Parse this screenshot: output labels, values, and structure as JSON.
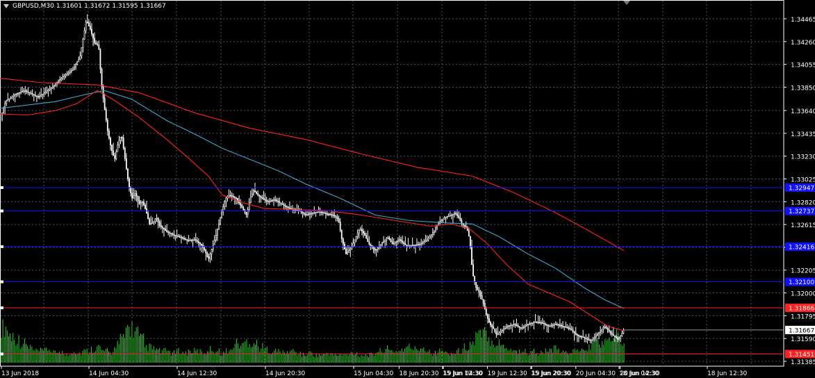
{
  "header": {
    "symbol": "GBPUSD,M30",
    "open": "1.31601",
    "high": "1.31672",
    "low": "1.31595",
    "close": "1.31667"
  },
  "colors": {
    "background": "#000000",
    "grid": "#4a5260",
    "axis": "#ffffff",
    "bull_candle": "#ffffff",
    "bear_candle": "#ffffff",
    "volume": "#2bcf2b",
    "ma_fast": "#ff2020",
    "ma_slow": "#ff2020",
    "ma_mid": "#3aa7c8",
    "blue_level": "#1010ff",
    "red_level": "#ff2020",
    "price_tag_bg": "#ffffff"
  },
  "price_axis": {
    "labels": [
      "1.34465",
      "1.34260",
      "1.34055",
      "1.33850",
      "1.33640",
      "1.33435",
      "1.33230",
      "1.33025",
      "1.32820",
      "1.32615",
      "1.32410",
      "1.32205",
      "1.32000",
      "1.31795",
      "1.31590",
      "1.31385"
    ],
    "current_price": "1.31667",
    "level_tags": [
      {
        "label": "1.32947",
        "kind": "blue"
      },
      {
        "label": "1.32737",
        "kind": "blue"
      },
      {
        "label": "1.32416",
        "kind": "blue"
      },
      {
        "label": "1.32100",
        "kind": "blue"
      },
      {
        "label": "1.31866",
        "kind": "red"
      },
      {
        "label": "1.31451",
        "kind": "red"
      }
    ]
  },
  "time_axis": {
    "labels": [
      "13 Jun 2018",
      "14 Jun 04:30",
      "14 Jun 12:30",
      "14 Jun 20:30",
      "15 Jun 04:30",
      "15 Jun 12:30",
      "15 Jun 20:30",
      "18 Jun 04:30",
      "18 Jun 12:30",
      "18 Jun 20:30",
      "19 Jun 04:30",
      "19 Jun 12:30",
      "19 Jun 20:30",
      "20 Jun 04:30",
      "20 Jun 12:30"
    ]
  },
  "chart_data": {
    "type": "candlestick",
    "symbol": "GBPUSD",
    "timeframe": "M30",
    "ylim": [
      1.31385,
      1.34465
    ],
    "y_ticks": [
      1.34465,
      1.3426,
      1.34055,
      1.3385,
      1.3364,
      1.33435,
      1.3323,
      1.33025,
      1.3282,
      1.32615,
      1.3241,
      1.32205,
      1.32,
      1.31795,
      1.3159,
      1.31385
    ],
    "x_tick_labels": [
      "13 Jun 2018",
      "14 Jun 04:30",
      "14 Jun 12:30",
      "14 Jun 20:30",
      "15 Jun 04:30",
      "15 Jun 12:30",
      "15 Jun 20:30",
      "18 Jun 04:30",
      "18 Jun 12:30",
      "18 Jun 20:30",
      "19 Jun 04:30",
      "19 Jun 12:30",
      "19 Jun 20:30",
      "20 Jun 04:30",
      "20 Jun 12:30"
    ],
    "close_path": [
      [
        0,
        1.3356
      ],
      [
        8,
        1.3372
      ],
      [
        20,
        1.3378
      ],
      [
        35,
        1.3382
      ],
      [
        55,
        1.3376
      ],
      [
        75,
        1.3385
      ],
      [
        90,
        1.3394
      ],
      [
        105,
        1.3401
      ],
      [
        115,
        1.3412
      ],
      [
        120,
        1.343
      ],
      [
        124,
        1.3445
      ],
      [
        130,
        1.3437
      ],
      [
        136,
        1.3425
      ],
      [
        142,
        1.3422
      ],
      [
        146,
        1.3388
      ],
      [
        150,
        1.3368
      ],
      [
        155,
        1.3345
      ],
      [
        160,
        1.333
      ],
      [
        165,
        1.332
      ],
      [
        170,
        1.3335
      ],
      [
        175,
        1.3342
      ],
      [
        180,
        1.332
      ],
      [
        185,
        1.3298
      ],
      [
        190,
        1.3285
      ],
      [
        195,
        1.329
      ],
      [
        200,
        1.328
      ],
      [
        205,
        1.3282
      ],
      [
        210,
        1.3274
      ],
      [
        215,
        1.3262
      ],
      [
        220,
        1.3263
      ],
      [
        225,
        1.3268
      ],
      [
        230,
        1.326
      ],
      [
        235,
        1.3258
      ],
      [
        240,
        1.3255
      ],
      [
        250,
        1.3252
      ],
      [
        260,
        1.325
      ],
      [
        270,
        1.3247
      ],
      [
        280,
        1.3248
      ],
      [
        290,
        1.3243
      ],
      [
        295,
        1.3238
      ],
      [
        300,
        1.323
      ],
      [
        305,
        1.324
      ],
      [
        310,
        1.325
      ],
      [
        315,
        1.3262
      ],
      [
        320,
        1.3275
      ],
      [
        325,
        1.3285
      ],
      [
        330,
        1.3288
      ],
      [
        340,
        1.3285
      ],
      [
        350,
        1.3275
      ],
      [
        355,
        1.327
      ],
      [
        360,
        1.3285
      ],
      [
        365,
        1.3292
      ],
      [
        375,
        1.3286
      ],
      [
        385,
        1.3282
      ],
      [
        395,
        1.3284
      ],
      [
        405,
        1.328
      ],
      [
        410,
        1.3278
      ],
      [
        420,
        1.3275
      ],
      [
        430,
        1.3274
      ],
      [
        440,
        1.327
      ],
      [
        450,
        1.3272
      ],
      [
        460,
        1.3273
      ],
      [
        470,
        1.3271
      ],
      [
        480,
        1.327
      ],
      [
        487,
        1.3266
      ],
      [
        492,
        1.3248
      ],
      [
        498,
        1.3235
      ],
      [
        505,
        1.324
      ],
      [
        512,
        1.325
      ],
      [
        518,
        1.3258
      ],
      [
        525,
        1.3252
      ],
      [
        530,
        1.3245
      ],
      [
        540,
        1.3238
      ],
      [
        550,
        1.3245
      ],
      [
        558,
        1.325
      ],
      [
        565,
        1.3244
      ],
      [
        575,
        1.3248
      ],
      [
        585,
        1.3242
      ],
      [
        595,
        1.3243
      ],
      [
        605,
        1.3244
      ],
      [
        615,
        1.3248
      ],
      [
        625,
        1.3256
      ],
      [
        630,
        1.3262
      ],
      [
        640,
        1.3268
      ],
      [
        650,
        1.327
      ],
      [
        655,
        1.3272
      ],
      [
        660,
        1.3268
      ],
      [
        665,
        1.3262
      ],
      [
        672,
        1.3258
      ],
      [
        676,
        1.3248
      ],
      [
        680,
        1.3218
      ],
      [
        685,
        1.3205
      ],
      [
        690,
        1.32
      ],
      [
        695,
        1.3192
      ],
      [
        700,
        1.318
      ],
      [
        705,
        1.3172
      ],
      [
        710,
        1.3168
      ],
      [
        715,
        1.3162
      ],
      [
        720,
        1.3165
      ],
      [
        730,
        1.317
      ],
      [
        740,
        1.3172
      ],
      [
        750,
        1.3168
      ],
      [
        760,
        1.3172
      ],
      [
        770,
        1.3174
      ],
      [
        780,
        1.3173
      ],
      [
        790,
        1.317
      ],
      [
        800,
        1.3172
      ],
      [
        810,
        1.317
      ],
      [
        820,
        1.3168
      ],
      [
        830,
        1.3162
      ],
      [
        840,
        1.316
      ],
      [
        850,
        1.3157
      ],
      [
        860,
        1.3163
      ],
      [
        870,
        1.317
      ],
      [
        880,
        1.3163
      ],
      [
        890,
        1.3158
      ],
      [
        898,
        1.31667
      ]
    ],
    "ma_fast_path": [
      [
        0,
        1.3361
      ],
      [
        40,
        1.336
      ],
      [
        80,
        1.3364
      ],
      [
        110,
        1.337
      ],
      [
        140,
        1.3382
      ],
      [
        160,
        1.3375
      ],
      [
        200,
        1.3358
      ],
      [
        240,
        1.3338
      ],
      [
        270,
        1.3322
      ],
      [
        300,
        1.3305
      ],
      [
        320,
        1.3288
      ],
      [
        350,
        1.3281
      ],
      [
        380,
        1.3276
      ],
      [
        420,
        1.3275
      ],
      [
        470,
        1.3274
      ],
      [
        520,
        1.327
      ],
      [
        570,
        1.3265
      ],
      [
        620,
        1.326
      ],
      [
        650,
        1.3262
      ],
      [
        675,
        1.3258
      ],
      [
        700,
        1.3245
      ],
      [
        730,
        1.3225
      ],
      [
        760,
        1.3208
      ],
      [
        790,
        1.32
      ],
      [
        820,
        1.3192
      ],
      [
        850,
        1.318
      ],
      [
        875,
        1.317
      ],
      [
        898,
        1.3166
      ]
    ],
    "ma_mid_path": [
      [
        0,
        1.3366
      ],
      [
        40,
        1.3369
      ],
      [
        80,
        1.3372
      ],
      [
        120,
        1.3378
      ],
      [
        150,
        1.3382
      ],
      [
        190,
        1.3374
      ],
      [
        240,
        1.3355
      ],
      [
        280,
        1.3343
      ],
      [
        320,
        1.333
      ],
      [
        360,
        1.332
      ],
      [
        400,
        1.331
      ],
      [
        440,
        1.3298
      ],
      [
        490,
        1.3285
      ],
      [
        540,
        1.327
      ],
      [
        590,
        1.3265
      ],
      [
        640,
        1.3263
      ],
      [
        680,
        1.3262
      ],
      [
        720,
        1.325
      ],
      [
        760,
        1.3235
      ],
      [
        800,
        1.3222
      ],
      [
        840,
        1.3205
      ],
      [
        870,
        1.3194
      ],
      [
        898,
        1.3186
      ]
    ],
    "ma_slow_path": [
      [
        0,
        1.3393
      ],
      [
        60,
        1.3389
      ],
      [
        140,
        1.3387
      ],
      [
        200,
        1.338
      ],
      [
        280,
        1.3362
      ],
      [
        360,
        1.3348
      ],
      [
        440,
        1.3338
      ],
      [
        520,
        1.3325
      ],
      [
        600,
        1.3313
      ],
      [
        680,
        1.3305
      ],
      [
        740,
        1.329
      ],
      [
        800,
        1.3272
      ],
      [
        850,
        1.3255
      ],
      [
        898,
        1.3238
      ]
    ],
    "levels": [
      {
        "price": 1.32947,
        "color": "blue"
      },
      {
        "price": 1.32737,
        "color": "blue"
      },
      {
        "price": 1.32416,
        "color": "blue"
      },
      {
        "price": 1.321,
        "color": "blue"
      },
      {
        "price": 1.31866,
        "color": "red"
      },
      {
        "price": 1.31451,
        "color": "red"
      }
    ],
    "volume_profile_relative": [
      0.9,
      0.7,
      0.6,
      0.5,
      0.4,
      0.3,
      0.3,
      0.35,
      0.25,
      0.3,
      0.2,
      0.3,
      0.25,
      0.3,
      0.35,
      0.4,
      0.3,
      0.25,
      0.5,
      0.6,
      0.9,
      0.8,
      0.6,
      0.4,
      0.35,
      0.3,
      0.3,
      0.25,
      0.3,
      0.25,
      0.3,
      0.3,
      0.25,
      0.35,
      0.3,
      0.25,
      0.3,
      0.5,
      0.45,
      0.55,
      0.5,
      0.4,
      0.35,
      0.3,
      0.3,
      0.25,
      0.3,
      0.25,
      0.2,
      0.25,
      0.2,
      0.2,
      0.25,
      0.2,
      0.2,
      0.2,
      0.25,
      0.2,
      0.2,
      0.2,
      0.3,
      0.35,
      0.3,
      0.3,
      0.35,
      0.4,
      0.35,
      0.4,
      0.3,
      0.25,
      0.3,
      0.25,
      0.25,
      0.3,
      0.4,
      0.5,
      0.7,
      0.75,
      0.6,
      0.5,
      0.45,
      0.35,
      0.3,
      0.3,
      0.25,
      0.3,
      0.25,
      0.3,
      0.35,
      0.3,
      0.25,
      0.3,
      0.35,
      0.3,
      0.45,
      0.55,
      0.5,
      0.6,
      0.7,
      0.6
    ]
  }
}
